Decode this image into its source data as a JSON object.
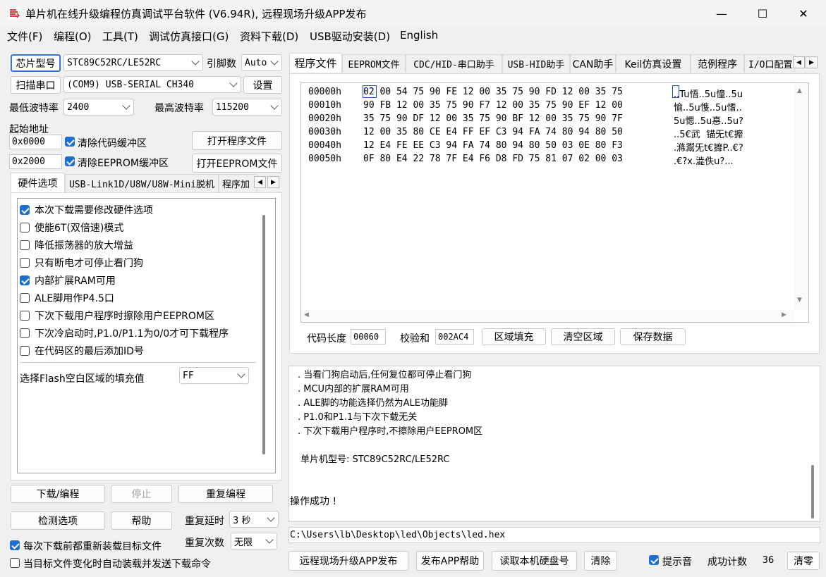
{
  "window": {
    "title": "单片机在线升级编程仿真调试平台软件 (V6.94R), 远程现场升级APP发布",
    "minimize": "—",
    "maximize": "☐",
    "close": "✕"
  },
  "menu": [
    "文件(F)",
    "编程(O)",
    "工具(T)",
    "调试仿真接口(G)",
    "资料下载(D)",
    "USB驱动安装(D)",
    "English"
  ],
  "left": {
    "chip_button": "芯片型号",
    "chip_value": "STC89C52RC/LE52RC",
    "pins_label": "引脚数",
    "pins_value": "Auto",
    "scan_button": "扫描串口",
    "port_value": "(COM9) USB-SERIAL CH340",
    "settings_button": "设置",
    "min_baud_label": "最低波特率",
    "min_baud_value": "2400",
    "max_baud_label": "最高波特率",
    "max_baud_value": "115200",
    "start_addr_label": "起始地址",
    "code_addr": "0x0000",
    "clear_code_label": "清除代码缓冲区",
    "open_prog_button": "打开程序文件",
    "eeprom_addr": "0x2000",
    "clear_eeprom_label": "清除EEPROM缓冲区",
    "open_eeprom_button": "打开EEPROM文件",
    "tabs": [
      "硬件选项",
      "USB-Link1D/U8W/U8W-Mini脱机",
      "程序加"
    ],
    "hw_options": [
      {
        "label": "本次下载需要修改硬件选项",
        "checked": true
      },
      {
        "label": "使能6T(双倍速)模式",
        "checked": false
      },
      {
        "label": "降低振荡器的放大增益",
        "checked": false
      },
      {
        "label": "只有断电才可停止看门狗",
        "checked": false
      },
      {
        "label": "内部扩展RAM可用",
        "checked": true
      },
      {
        "label": "ALE脚用作P4.5口",
        "checked": false
      },
      {
        "label": "下次下载用户程序时擦除用户EEPROM区",
        "checked": false
      },
      {
        "label": "下次冷启动时,P1.0/P1.1为0/0才可下载程序",
        "checked": false
      },
      {
        "label": "在代码区的最后添加ID号",
        "checked": false
      }
    ],
    "fill_label": "选择Flash空白区域的填充值",
    "fill_value": "FF",
    "download_button": "下载/编程",
    "stop_button": "停止",
    "reprogram_button": "重复编程",
    "detect_button": "检测选项",
    "help_button": "帮助",
    "repeat_delay_label": "重复延时",
    "repeat_delay_value": "3 秒",
    "repeat_count_label": "重复次数",
    "repeat_count_value": "无限",
    "reload_label": "每次下载前都重新装载目标文件",
    "auto_load_label": "当目标文件变化时自动装载并发送下载命令"
  },
  "right": {
    "tabs": [
      "程序文件",
      "EEPROM文件",
      "CDC/HID-串口助手",
      "USB-HID助手",
      "CAN助手",
      "Keil仿真设置",
      "范例程序",
      "I/O口配置"
    ],
    "hex_rows": [
      {
        "addr": "00000h",
        "bytes": "02 00 54 75 90 FE 12 00 35 75 90 FD 12 00 35 75",
        "ascii": "..Tu悟..5u憧..5u"
      },
      {
        "addr": "00010h",
        "bytes": "90 FB 12 00 35 75 90 F7 12 00 35 75 90 EF 12 00",
        "ascii": "愉..5u愯..5u愭.."
      },
      {
        "addr": "00020h",
        "bytes": "35 75 90 DF 12 00 35 75 90 BF 12 00 35 75 90 7F",
        "ascii": "5u愢..5u惪..5u?"
      },
      {
        "addr": "00030h",
        "bytes": "12 00 35 80 CE E4 FF EF C3 94 FA 74 80 94 80 50",
        "ascii": "..5€武  锚旡t€攠"
      },
      {
        "addr": "00040h",
        "bytes": "12 E4 FE EE C3 94 FA 74 80 94 80 50 03 0E 80 F3",
        "ascii": ".滌鬻旡t€攠P..€?"
      },
      {
        "addr": "00050h",
        "bytes": "0F 80 E4 22 78 7F E4 F6 D8 FD 75 81 07 02 00 03",
        "ascii": ".€?x.澁佚u?..."
      }
    ],
    "code_len_label": "代码长度",
    "code_len_value": "00060",
    "checksum_label": "校验和",
    "checksum_value": "002AC4",
    "fill_area_button": "区域填充",
    "clear_area_button": "清空区域",
    "save_data_button": "保存数据",
    "log_lines": [
      ". 当看门狗启动后,任何复位都可停止看门狗",
      ". MCU内部的扩展RAM可用",
      ". ALE脚的功能选择仍然为ALE功能脚",
      ". P1.0和P1.1与下次下载无关",
      ". 下次下载用户程序时,不擦除用户EEPROM区",
      "",
      "单片机型号: STC89C52RC/LE52RC",
      "",
      "",
      "操作成功 !"
    ],
    "file_path": "C:\\Users\\lb\\Desktop\\led\\Objects\\led.hex",
    "remote_upgrade_button": "远程现场升级APP发布",
    "publish_help_button": "发布APP帮助",
    "read_disk_button": "读取本机硬盘号",
    "clear_button": "清除",
    "beep_label": "提示音",
    "success_count_label": "成功计数",
    "success_count_value": "36",
    "reset_button": "清零"
  },
  "colors": {
    "accent": "#1f6fd0",
    "window_bg": "#f0f0f0",
    "icon": "#d63b3b"
  }
}
